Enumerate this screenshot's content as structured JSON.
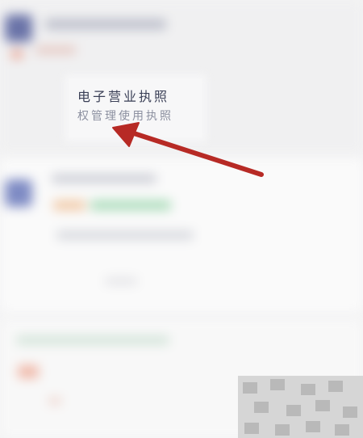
{
  "callout": {
    "title": "电子营业执照",
    "subtitle": "权管理使用执照"
  },
  "annotation": {
    "arrow_color": "#b72a25"
  }
}
